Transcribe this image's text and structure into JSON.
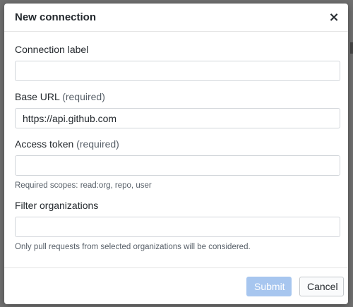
{
  "modal": {
    "title": "New connection",
    "close_glyph": "×"
  },
  "fields": [
    {
      "label": "Connection label",
      "required_text": "",
      "value": "",
      "placeholder": "",
      "note": ""
    },
    {
      "label": "Base URL",
      "required_text": "(required)",
      "value": "https://api.github.com",
      "placeholder": "",
      "note": ""
    },
    {
      "label": "Access token",
      "required_text": "(required)",
      "value": "",
      "placeholder": "",
      "note": "Required scopes: read:org, repo, user"
    },
    {
      "label": "Filter organizations",
      "required_text": "",
      "value": "",
      "placeholder": "",
      "note": "Only pull requests from selected organizations will be considered."
    }
  ],
  "footer": {
    "submit_label": "Submit",
    "cancel_label": "Cancel"
  },
  "colors": {
    "submit_disabled_bg": "#a7c6ef",
    "backdrop": "#707070",
    "required_text": "#586069"
  },
  "icons": {
    "close": "close-icon"
  }
}
